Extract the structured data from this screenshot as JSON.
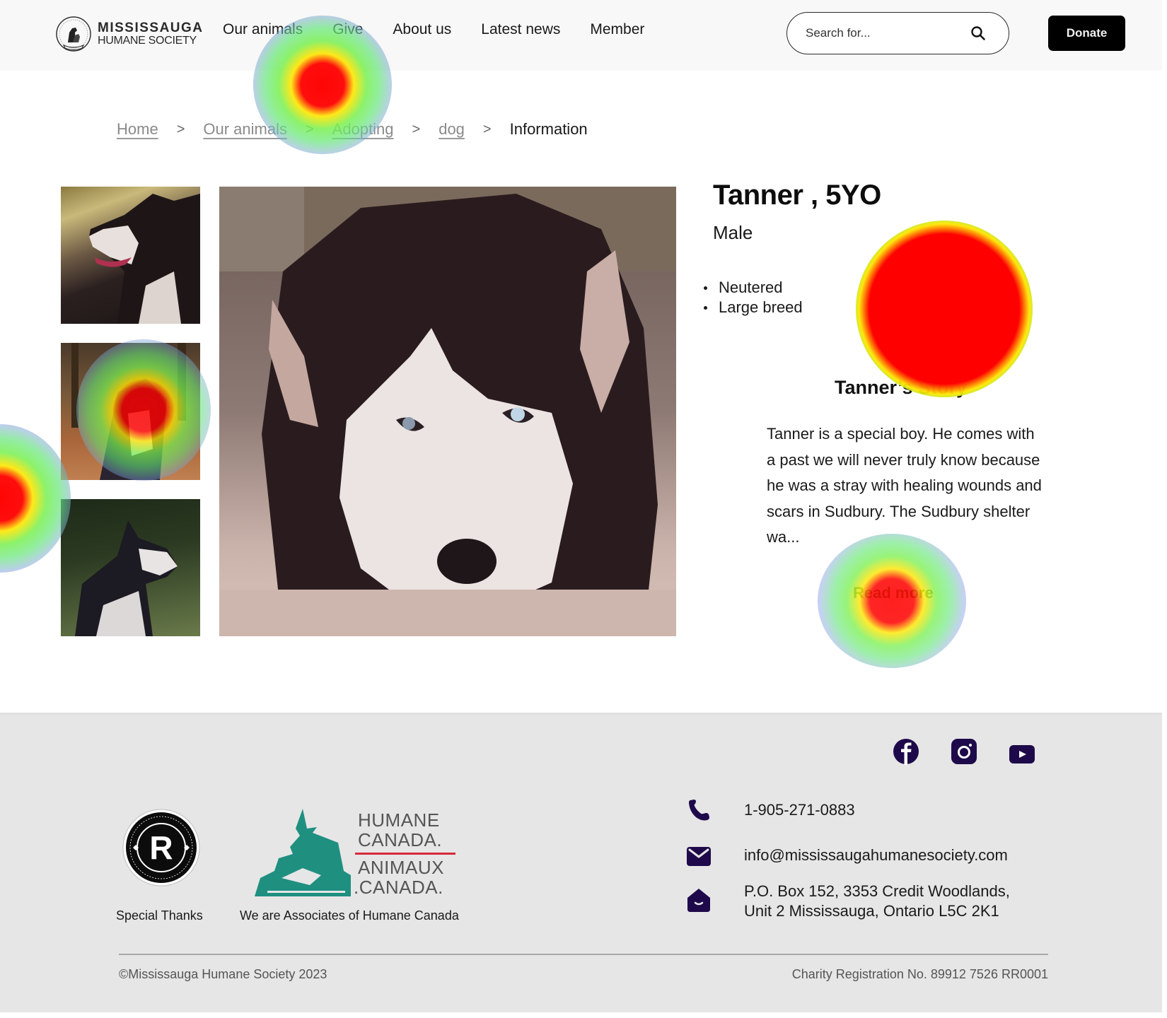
{
  "header": {
    "logo_line1": "MISSISSAUGA",
    "logo_line2": "HUMANE SOCIETY",
    "nav": [
      {
        "label": "Our animals"
      },
      {
        "label": "Give"
      },
      {
        "label": "About us"
      },
      {
        "label": "Latest news"
      },
      {
        "label": "Member"
      }
    ],
    "search_placeholder": "Search for...",
    "search_icon": "search-icon",
    "donate_label": "Donate"
  },
  "breadcrumb": {
    "items": [
      "Home",
      "Our animals",
      "Adopting",
      "dog"
    ],
    "current": "Information",
    "separator": ">"
  },
  "gallery": {
    "thumbnails": [
      "husky-profile-photo",
      "husky-autumn-photo",
      "husky-grass-photo"
    ],
    "main": "husky-lying-photo"
  },
  "pet": {
    "name": "Tanner , 5YO",
    "sex": "Male",
    "traits": [
      "Neutered",
      "Large breed"
    ],
    "story_title": "Tanner’s Story",
    "story_text": "Tanner is a special boy. He comes with a past we will never truly know because he was a stray with healing wounds and scars in Sudbury. The Sudbury shelter wa...",
    "read_more": "Read more"
  },
  "footer": {
    "social": [
      "facebook-icon",
      "instagram-icon",
      "youtube-icon"
    ],
    "phone": "1-905-271-0883",
    "email": "info@mississaugahumanesociety.com",
    "address_line1": "P.O. Box 152, 3353 Credit Woodlands,",
    "address_line2": "Unit 2 Mississauga, Ontario L5C 2K1",
    "sponsor_caption": "Special Thanks",
    "sponsor_badge_letter": "R",
    "associate_caption": "We are Associates of Humane Canada",
    "hc_logo": {
      "line1": "HUMANE",
      "line2": "CANADA.",
      "line3": "ANIMAUX",
      "line4": ".CANADA."
    },
    "copyright": "©Mississauga Humane Society 2023",
    "charity": "Charity Registration No. 89912 7526 RR0001"
  },
  "colors": {
    "icon_purple": "#1e0a4a",
    "accent_green": "#1a8a2a",
    "footer_bg": "#e6e6e6",
    "hc_teal": "#1f8f80",
    "hc_red": "#d8283a"
  }
}
